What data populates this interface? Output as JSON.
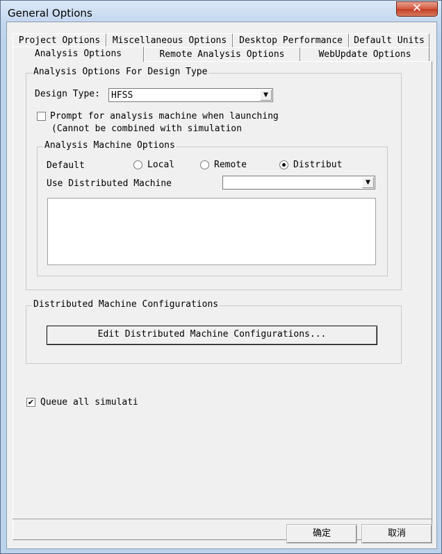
{
  "window": {
    "title": "General Options",
    "close_glyph": "✕"
  },
  "tabs": {
    "row1": [
      {
        "label": "Project Options"
      },
      {
        "label": "Miscellaneous Options"
      },
      {
        "label": "Desktop Performance"
      },
      {
        "label": "Default Units"
      }
    ],
    "row2": [
      {
        "label": "Analysis Options",
        "active": true
      },
      {
        "label": "Remote Analysis Options"
      },
      {
        "label": "WebUpdate Options"
      }
    ]
  },
  "design_type_group": {
    "legend": "Analysis Options For Design Type",
    "design_type_label": "Design Type:",
    "design_type_value": "HFSS",
    "prompt_line1": "Prompt for analysis machine when launching",
    "prompt_line2": "(Cannot be combined with simulation",
    "prompt_checked": false,
    "machine_group": {
      "legend": "Analysis Machine Options",
      "default_label": "Default",
      "radio_local": "Local",
      "radio_remote": "Remote",
      "radio_distributed": "Distribut",
      "selected": "distributed",
      "use_distributed_label": "Use Distributed Machine",
      "distributed_combo_value": ""
    }
  },
  "dist_config_group": {
    "legend": "Distributed Machine Configurations",
    "edit_button": "Edit Distributed Machine Configurations..."
  },
  "queue": {
    "label": "Queue all simulati",
    "checked": true,
    "check_glyph": "✔"
  },
  "footer": {
    "ok": "确定",
    "cancel": "取消"
  },
  "icons": {
    "dropdown": "▼"
  }
}
